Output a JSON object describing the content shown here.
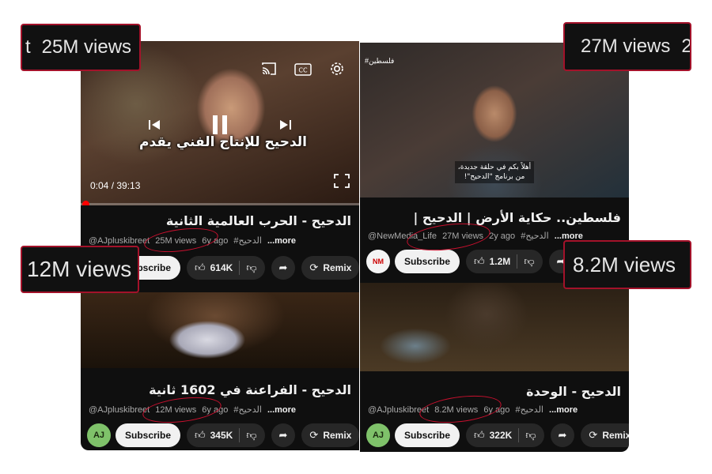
{
  "colors": {
    "background": "#0f0f0f",
    "subscribe_bg": "#f1f1f1",
    "pill_bg": "#272727",
    "meta_text": "#aaaaaa",
    "annotation_border": "#a3122a",
    "progress_red": "#ff0000"
  },
  "cards": [
    {
      "title": "الدحيح - الحرب العالمية الثانية",
      "thumb_overlay_title": "الدحيح للإنتاج الفني يقدم",
      "time": "0:04 / 39:13",
      "progress": 0.0017,
      "channel": "@AJpluskibreet",
      "views": "25M views",
      "age": "6y ago",
      "hashtag": "#الدحيح",
      "more": "...more",
      "subscribe": "Subscribe",
      "likes": "614K",
      "remix": "Remix",
      "icons": {
        "cast": "cast-icon",
        "cc": "closed-captions-icon",
        "settings": "gear-icon",
        "prev": "skip-previous-icon",
        "pause": "pause-icon",
        "next": "skip-next-icon",
        "fullscreen": "fullscreen-icon"
      }
    },
    {
      "title": "الدحيح - الفراعنة في 1602 ثانية",
      "channel": "@AJpluskibreet",
      "views": "12M views",
      "age": "6y ago",
      "hashtag": "#الدحيح",
      "more": "...more",
      "subscribe": "Subscribe",
      "likes": "345K",
      "remix": "Remix"
    },
    {
      "title": "فلسطين.. حكاية الأرض | الدحيح |",
      "hashtag_top": "#فلسطين",
      "caption_line1": "أهلاً بكم في حلقة جديدة،",
      "caption_line2": "من برنامج \"الدحيح\"!",
      "channel": "@NewMedia_Life",
      "views": "27M views",
      "age": "2y ago",
      "hashtag": "#الدحيح",
      "more": "...more",
      "subscribe": "Subscribe",
      "likes": "1.2M"
    },
    {
      "title": "الدحيح - الوحدة",
      "channel": "@AJpluskibreet",
      "views": "8.2M views",
      "age": "6y ago",
      "hashtag": "#الدحيح",
      "more": "...more",
      "subscribe": "Subscribe",
      "likes": "322K",
      "remix": "Remix"
    }
  ],
  "annotations": {
    "tl": {
      "text": "25M views",
      "prefix": "t"
    },
    "tr": {
      "text": "27M views",
      "suffix": "2"
    },
    "ml": {
      "text": "12M views"
    },
    "mr": {
      "text": "8.2M views"
    }
  }
}
